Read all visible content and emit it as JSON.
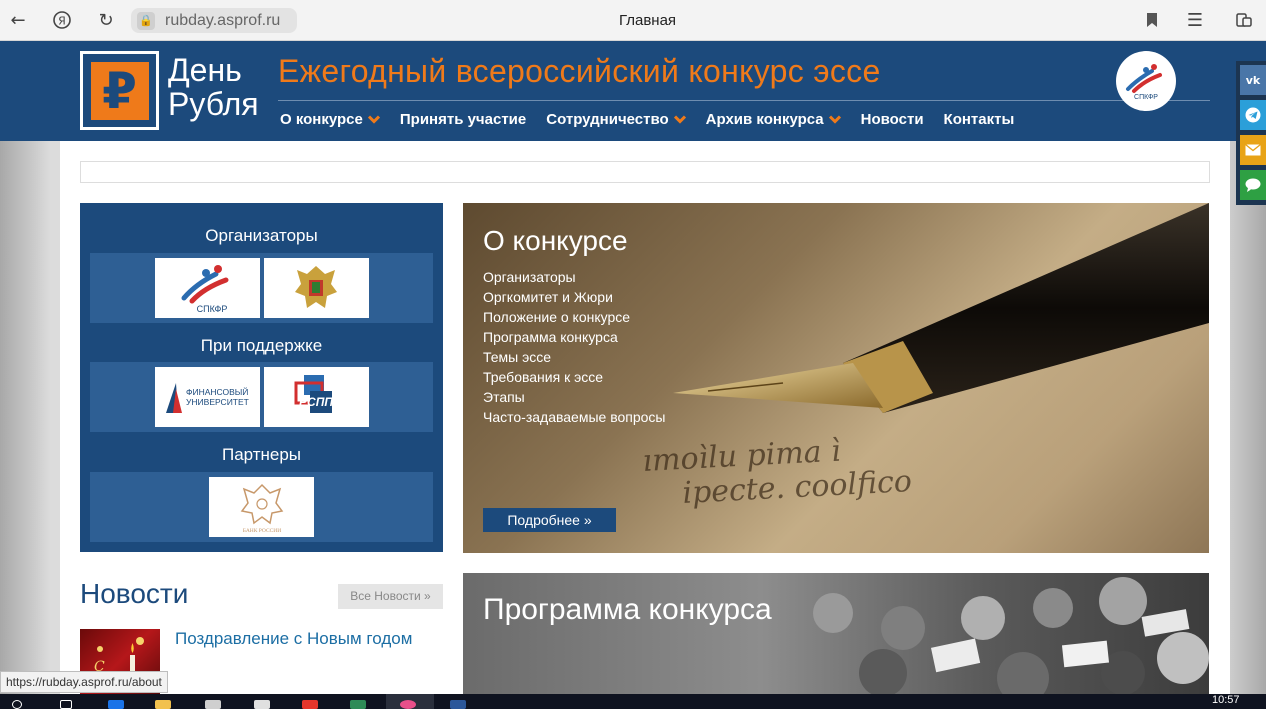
{
  "browser": {
    "url": "rubday.asprof.ru",
    "page_title": "Главная",
    "status_url": "https://rubday.asprof.ru/about"
  },
  "header": {
    "logo_glyph": "₽",
    "logo_line1": "День",
    "logo_line2": "Рубля",
    "title": "Ежегодный всероссийский конкурс эссе",
    "partner_badge": "СПКФР"
  },
  "nav": [
    {
      "label": "О конкурсе",
      "dropdown": true
    },
    {
      "label": "Принять участие",
      "dropdown": false
    },
    {
      "label": "Сотрудничество",
      "dropdown": true
    },
    {
      "label": "Архив конкурса",
      "dropdown": true
    },
    {
      "label": "Новости",
      "dropdown": false
    },
    {
      "label": "Контакты",
      "dropdown": false
    }
  ],
  "share": [
    {
      "label": "vk",
      "color": "#4a76a8"
    },
    {
      "label": "telegram",
      "color": "#2b9fd9"
    },
    {
      "label": "email",
      "color": "#e8a317"
    },
    {
      "label": "chat",
      "color": "#2ea043"
    }
  ],
  "left_panel": {
    "organizers": "Организаторы",
    "support": "При поддержке",
    "partners": "Партнеры",
    "logos": {
      "spkfr": "СПКФР",
      "fin_univ_1": "ФИНАНСОВЫЙ",
      "fin_univ_2": "УНИВЕРСИТЕТ",
      "rspp": "РСПП",
      "bank": "БАНК РОССИИ"
    }
  },
  "about": {
    "title": "О конкурсе",
    "links": [
      "Организаторы",
      "Оргкомитет и Жюри",
      "Положение о конкурсе",
      "Программа конкурса",
      "Темы эссе",
      "Требования к эссе",
      "Этапы",
      "Часто-задаваемые вопросы"
    ],
    "more": "Подробнее »"
  },
  "program": {
    "title": "Программа конкурса"
  },
  "news": {
    "title": "Новости",
    "all": "Все Новости »",
    "item1": "Поздравление с Новым годом"
  },
  "taskbar": {
    "time": "10:57"
  },
  "colors": {
    "brand_blue": "#1c4a7c",
    "accent_orange": "#ef7a1a",
    "link_blue": "#1c6ea4"
  }
}
